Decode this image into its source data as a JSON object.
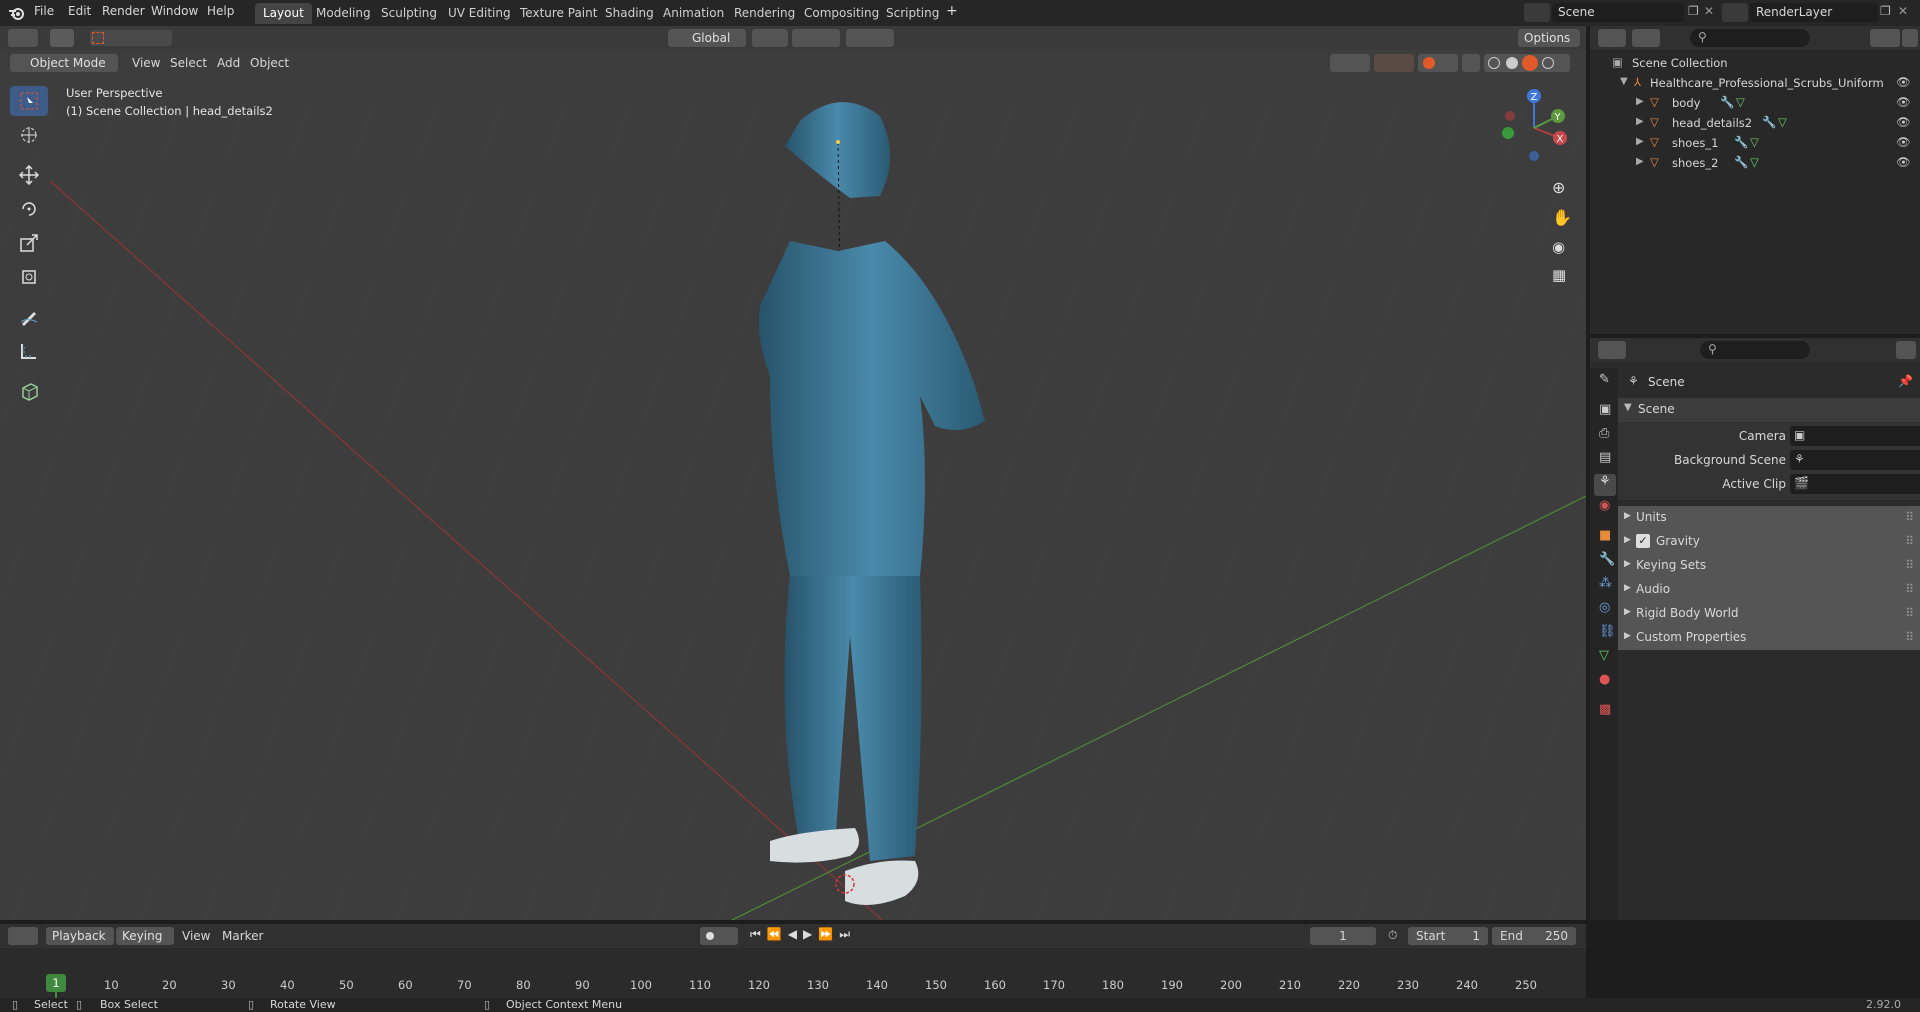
{
  "menubar": {
    "items": [
      "File",
      "Edit",
      "Render",
      "Window",
      "Help"
    ],
    "workspace_tabs": [
      "Layout",
      "Modeling",
      "Sculpting",
      "UV Editing",
      "Texture Paint",
      "Shading",
      "Animation",
      "Rendering",
      "Compositing",
      "Scripting"
    ],
    "active_tab": "Layout",
    "add_tab": "+",
    "scene_name": "Scene",
    "view_layer": "RenderLayer"
  },
  "viewport_header": {
    "mode": "Object Mode",
    "menus": [
      "View",
      "Select",
      "Add",
      "Object"
    ],
    "transform_orientation": "Global",
    "options_label": "Options"
  },
  "viewport": {
    "perspective_label": "User Perspective",
    "collection_label": "(1) Scene Collection | head_details2",
    "gizmo_axes": {
      "x": "X",
      "y": "Y",
      "z": "Z"
    }
  },
  "tools": [
    "select-box",
    "cursor",
    "move",
    "rotate",
    "scale",
    "transform",
    "annotate",
    "measure",
    "add-cube"
  ],
  "outliner": {
    "root": "Scene Collection",
    "collection": "Healthcare_Professional_Scrubs_Uniform",
    "objects": [
      {
        "name": "body"
      },
      {
        "name": "head_details2"
      },
      {
        "name": "shoes_1"
      },
      {
        "name": "shoes_2"
      }
    ]
  },
  "properties": {
    "context": "Scene",
    "panel_title": "Scene",
    "fields": [
      {
        "label": "Camera",
        "value": ""
      },
      {
        "label": "Background Scene",
        "value": ""
      },
      {
        "label": "Active Clip",
        "value": ""
      }
    ],
    "subpanels": [
      {
        "label": "Units",
        "checkbox": false
      },
      {
        "label": "Gravity",
        "checkbox": true
      },
      {
        "label": "Keying Sets",
        "checkbox": false
      },
      {
        "label": "Audio",
        "checkbox": false
      },
      {
        "label": "Rigid Body World",
        "checkbox": false
      },
      {
        "label": "Custom Properties",
        "checkbox": false
      }
    ]
  },
  "timeline": {
    "menus": [
      "Playback",
      "Keying",
      "View",
      "Marker"
    ],
    "current_frame": "1",
    "start_label": "Start",
    "start": "1",
    "end_label": "End",
    "end": "250",
    "ruler": [
      "10",
      "20",
      "30",
      "40",
      "50",
      "60",
      "70",
      "80",
      "90",
      "100",
      "110",
      "120",
      "130",
      "140",
      "150",
      "160",
      "170",
      "180",
      "190",
      "200",
      "210",
      "220",
      "230",
      "240",
      "250"
    ],
    "playhead": "1"
  },
  "statusbar": {
    "select": "Select",
    "box_select": "Box Select",
    "rotate_view": "Rotate View",
    "context_menu": "Object Context Menu",
    "version": "2.92.0"
  },
  "colors": {
    "accent": "#3f5b88",
    "x_axis": "#b04040",
    "y_axis": "#5c9a3c",
    "z_axis": "#3e77d6",
    "scrubs": "#3c7a9a",
    "object_orange": "#e58a3a"
  }
}
